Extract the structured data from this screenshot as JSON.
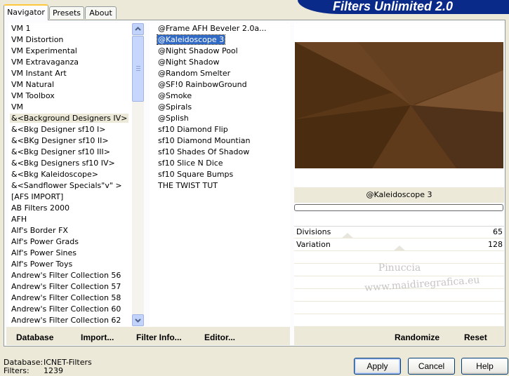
{
  "tabs": [
    "Navigator",
    "Presets",
    "About"
  ],
  "banner_title": "Filters Unlimited 2.0",
  "categories": [
    "VM 1",
    "VM Distortion",
    "VM Experimental",
    "VM Extravaganza",
    "VM Instant Art",
    "VM Natural",
    "VM Toolbox",
    "VM",
    "&<Background Designers IV>",
    "&<Bkg Designer sf10 I>",
    "&<BKg Designer sf10 II>",
    "&<Bkg Designer sf10 III>",
    "&<Bkg Designers sf10 IV>",
    "&<Bkg Kaleidoscope>",
    "&<Sandflower Specials\"v\" >",
    "[AFS IMPORT]",
    "AB Filters 2000",
    "AFH",
    "Alf's Border FX",
    "Alf's Power Grads",
    "Alf's Power Sines",
    "Alf's Power Toys",
    "Andrew's Filter Collection 56",
    "Andrew's Filter Collection 57",
    "Andrew's Filter Collection 58",
    "Andrew's Filter Collection 60",
    "Andrew's Filter Collection 62"
  ],
  "selected_category": "&<Background Designers IV>",
  "filters": [
    "@Frame AFH Beveler 2.0a...",
    "@Kaleidoscope 3",
    "@Night Shadow Pool",
    "@Night Shadow",
    "@Random Smelter",
    "@SF!0 RainbowGround",
    "@Smoke",
    "@Spirals",
    "@Splish",
    "sf10 Diamond Flip",
    "sf10 Diamond Mountian",
    "sf10 Shades Of Shadow",
    "sf10 Slice N Dice",
    "sf10 Square Bumps",
    "THE TWIST TUT"
  ],
  "selected_filter": "@Kaleidoscope 3",
  "current_filter_name": "@Kaleidoscope 3",
  "params": [
    {
      "label": "Divisions",
      "value": "65",
      "level": 0.255
    },
    {
      "label": "Variation",
      "value": "128",
      "level": 0.502
    }
  ],
  "watermark": {
    "line1": "Pinuccia",
    "line2": "www.maidiregrafica.eu"
  },
  "bottom_buttons": [
    "Database",
    "Import...",
    "Filter Info...",
    "Editor..."
  ],
  "randomize_label": "Randomize",
  "reset_label": "Reset",
  "status": {
    "database_label": "Database:",
    "database_value": "ICNET-Filters",
    "filters_label": "Filters:",
    "filters_value": "1239"
  },
  "dialog_buttons": {
    "apply": "Apply",
    "cancel": "Cancel",
    "help": "Help"
  },
  "colors": {
    "banner": "#0a2a8a",
    "selection": "#316ac5",
    "preview_brown": "#5b3818"
  }
}
